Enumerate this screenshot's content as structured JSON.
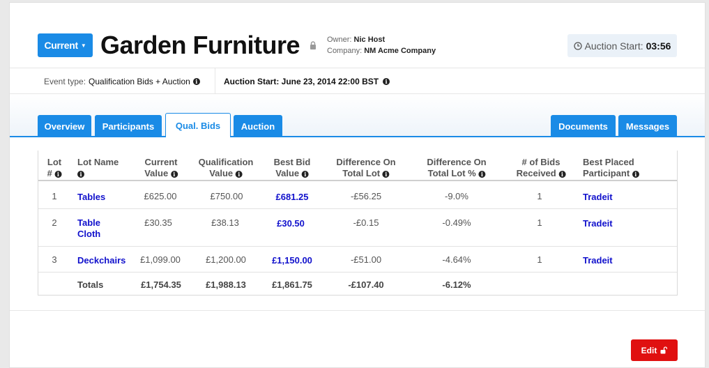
{
  "header": {
    "status_label": "Current",
    "title": "Garden Furniture",
    "owner_label": "Owner:",
    "owner_value": "Nic Host",
    "company_label": "Company:",
    "company_value": "NM Acme Company",
    "timer_label": "Auction Start:",
    "timer_value": "03:56"
  },
  "infobar": {
    "event_type_label": "Event type:",
    "event_type_value": "Qualification Bids + Auction",
    "auction_start": "Auction Start: June 23, 2014 22:00 BST"
  },
  "tabs": {
    "overview": "Overview",
    "participants": "Participants",
    "qual_bids": "Qual. Bids",
    "auction": "Auction",
    "documents": "Documents",
    "messages": "Messages"
  },
  "table": {
    "headers": {
      "lot_1": "Lot",
      "lot_2": "#",
      "lot_name": "Lot Name",
      "current_1": "Current",
      "current_2": "Value",
      "qual_1": "Qualification",
      "qual_2": "Value",
      "best_1": "Best Bid",
      "best_2": "Value",
      "diff_1": "Difference On",
      "diff_2": "Total Lot",
      "diffp_1": "Difference On",
      "diffp_2": "Total Lot %",
      "bids_1": "# of Bids",
      "bids_2": "Received",
      "placed_1": "Best Placed",
      "placed_2": "Participant"
    },
    "rows": [
      {
        "lot": "1",
        "name": "Tables",
        "name2": "",
        "current": "£625.00",
        "qual": "£750.00",
        "best": "£681.25",
        "diff": "-£56.25",
        "diffp": "-9.0%",
        "bids": "1",
        "placed": "Tradeit"
      },
      {
        "lot": "2",
        "name": "Table",
        "name2": "Cloth",
        "current": "£30.35",
        "qual": "£38.13",
        "best": "£30.50",
        "diff": "-£0.15",
        "diffp": "-0.49%",
        "bids": "1",
        "placed": "Tradeit"
      },
      {
        "lot": "3",
        "name": "Deckchairs",
        "name2": "",
        "current": "£1,099.00",
        "qual": "£1,200.00",
        "best": "£1,150.00",
        "diff": "-£51.00",
        "diffp": "-4.64%",
        "bids": "1",
        "placed": "Tradeit"
      }
    ],
    "totals": {
      "label": "Totals",
      "current": "£1,754.35",
      "qual": "£1,988.13",
      "best": "£1,861.75",
      "diff": "-£107.40",
      "diffp": "-6.12%"
    }
  },
  "footer": {
    "edit_label": "Edit"
  },
  "colors": {
    "accent": "#1a8be6",
    "link": "#1111cc",
    "danger": "#e01010"
  }
}
